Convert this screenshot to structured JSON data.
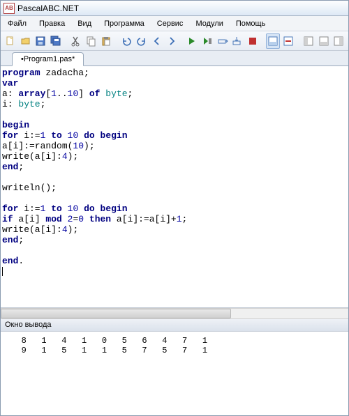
{
  "title": "PascalABC.NET",
  "menu": [
    "Файл",
    "Правка",
    "Вид",
    "Программа",
    "Сервис",
    "Модули",
    "Помощь"
  ],
  "tab": "•Program1.pas*",
  "code_tokens": [
    [
      [
        "kw",
        "program"
      ],
      [
        "tx",
        " zadacha;"
      ]
    ],
    [
      [
        "kw",
        "var"
      ]
    ],
    [
      [
        "tx",
        "a: "
      ],
      [
        "kw",
        "array"
      ],
      [
        "tx",
        "["
      ],
      [
        "num",
        "1"
      ],
      [
        "tx",
        ".."
      ],
      [
        "num",
        "10"
      ],
      [
        "tx",
        "] "
      ],
      [
        "kw",
        "of"
      ],
      [
        "tx",
        " "
      ],
      [
        "typ",
        "byte"
      ],
      [
        "tx",
        ";"
      ]
    ],
    [
      [
        "tx",
        "i: "
      ],
      [
        "typ",
        "byte"
      ],
      [
        "tx",
        ";"
      ]
    ],
    [],
    [
      [
        "kw",
        "begin"
      ]
    ],
    [
      [
        "kw",
        "for"
      ],
      [
        "tx",
        " i:="
      ],
      [
        "num",
        "1"
      ],
      [
        "tx",
        " "
      ],
      [
        "kw",
        "to"
      ],
      [
        "tx",
        " "
      ],
      [
        "num",
        "10"
      ],
      [
        "tx",
        " "
      ],
      [
        "kw",
        "do"
      ],
      [
        "tx",
        " "
      ],
      [
        "kw",
        "begin"
      ]
    ],
    [
      [
        "tx",
        "a[i]:=random("
      ],
      [
        "num",
        "10"
      ],
      [
        "tx",
        ");"
      ]
    ],
    [
      [
        "tx",
        "write(a[i]:"
      ],
      [
        "num",
        "4"
      ],
      [
        "tx",
        ");"
      ]
    ],
    [
      [
        "kw",
        "end"
      ],
      [
        "tx",
        ";"
      ]
    ],
    [],
    [
      [
        "tx",
        "writeln();"
      ]
    ],
    [],
    [
      [
        "kw",
        "for"
      ],
      [
        "tx",
        " i:="
      ],
      [
        "num",
        "1"
      ],
      [
        "tx",
        " "
      ],
      [
        "kw",
        "to"
      ],
      [
        "tx",
        " "
      ],
      [
        "num",
        "10"
      ],
      [
        "tx",
        " "
      ],
      [
        "kw",
        "do"
      ],
      [
        "tx",
        " "
      ],
      [
        "kw",
        "begin"
      ]
    ],
    [
      [
        "kw",
        "if"
      ],
      [
        "tx",
        " a[i] "
      ],
      [
        "kw",
        "mod"
      ],
      [
        "tx",
        " "
      ],
      [
        "num",
        "2"
      ],
      [
        "tx",
        "="
      ],
      [
        "num",
        "0"
      ],
      [
        "tx",
        " "
      ],
      [
        "kw",
        "then"
      ],
      [
        "tx",
        " a[i]:=a[i]+"
      ],
      [
        "num",
        "1"
      ],
      [
        "tx",
        ";"
      ]
    ],
    [
      [
        "tx",
        "write(a[i]:"
      ],
      [
        "num",
        "4"
      ],
      [
        "tx",
        ");"
      ]
    ],
    [
      [
        "kw",
        "end"
      ],
      [
        "tx",
        ";"
      ]
    ],
    [],
    [
      [
        "kw",
        "end"
      ],
      [
        "tx",
        "."
      ]
    ]
  ],
  "output_title": "Окно вывода",
  "output_rows": [
    [
      8,
      1,
      4,
      1,
      0,
      5,
      6,
      4,
      7,
      1
    ],
    [
      9,
      1,
      5,
      1,
      1,
      5,
      7,
      5,
      7,
      1
    ]
  ],
  "icons": {
    "new": "new-file-icon",
    "open": "open-icon",
    "save": "save-icon",
    "saveall": "save-all-icon",
    "cut": "cut-icon",
    "copy": "copy-icon",
    "paste": "paste-icon",
    "undo": "undo-icon",
    "redo": "redo-icon",
    "back": "back-icon",
    "fwd": "forward-icon",
    "run": "run-icon",
    "runinto": "run-console-icon",
    "stepover": "step-over-icon",
    "stepin": "step-in-icon",
    "stop": "stop-icon",
    "pane1": "pane1-icon",
    "pane2": "pane2-icon",
    "pane3": "pane3-icon",
    "pane4": "pane4-icon",
    "pane5": "pane5-icon"
  }
}
